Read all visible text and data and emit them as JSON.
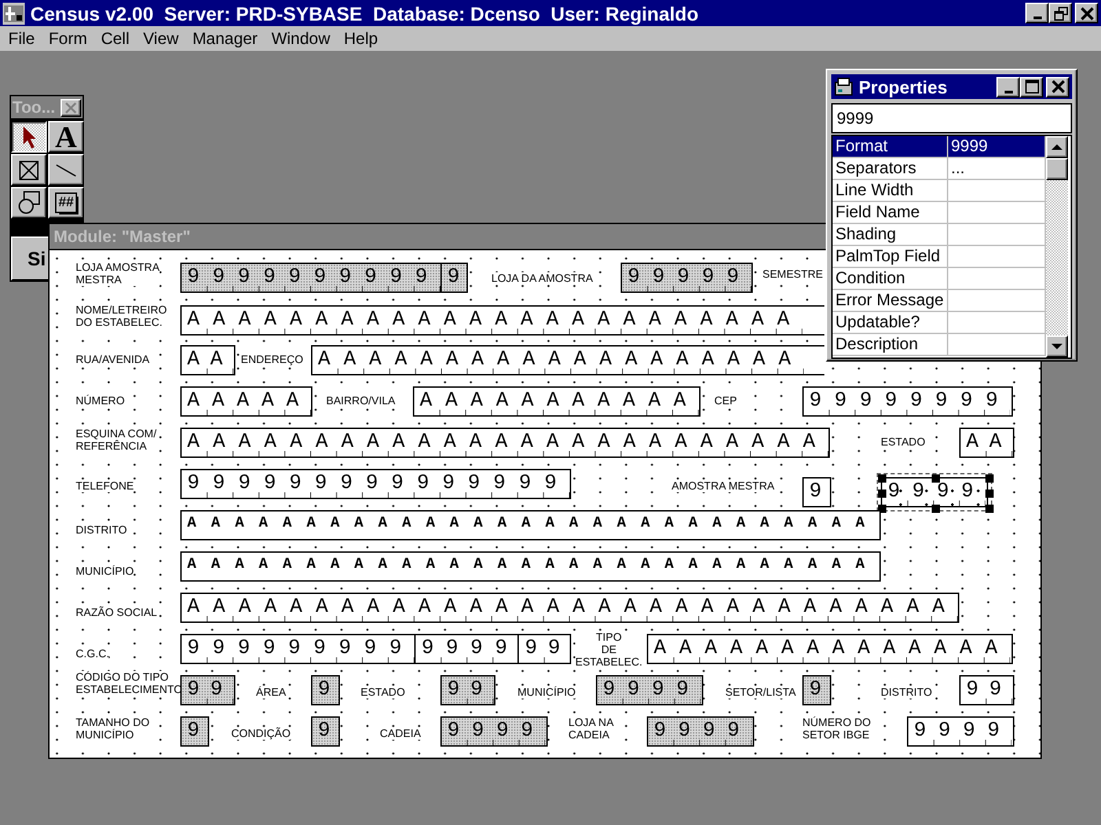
{
  "app": {
    "title": "Census v2.00  Server: PRD-SYBASE  Database: Dcenso  User: Reginaldo"
  },
  "menu": [
    "File",
    "Form",
    "Cell",
    "View",
    "Manager",
    "Window",
    "Help"
  ],
  "toolbox": {
    "title": "Too...",
    "tools": [
      {
        "kind": "pointer",
        "selected": true
      },
      {
        "kind": "text",
        "glyph": "A",
        "selected": false
      },
      {
        "kind": "frame",
        "selected": false
      },
      {
        "kind": "line",
        "selected": false
      },
      {
        "kind": "shapes",
        "selected": false
      },
      {
        "kind": "number",
        "glyph": "##",
        "selected": false
      }
    ],
    "button": "Si"
  },
  "module": {
    "title": "Module: \"Master\"",
    "items": [
      {
        "kind": "label",
        "text": "LOJA AMOSTRA\nMESTRA"
      },
      {
        "kind": "field",
        "groups": [
          "9999999999",
          "9"
        ],
        "shaded": true,
        "ticked": true,
        "selected": false
      },
      {
        "kind": "label",
        "text": "LOJA DA AMOSTRA"
      },
      {
        "kind": "field",
        "groups": [
          "99999"
        ],
        "shaded": true,
        "ticked": true,
        "selected": false
      },
      {
        "kind": "label",
        "text": "SEMESTRE"
      },
      {
        "kind": "label",
        "text": "NOME/LETREIRO\nDO ESTABELEC."
      },
      {
        "kind": "field",
        "groups": [
          "AAAAAAAAAAAAAAAAAAAAAAAA"
        ],
        "shaded": false,
        "ticked": true,
        "selected": false
      },
      {
        "kind": "label",
        "text": "RUA/AVENIDA"
      },
      {
        "kind": "field",
        "groups": [
          "AA"
        ],
        "shaded": false,
        "ticked": true,
        "selected": false
      },
      {
        "kind": "label",
        "text": "ENDEREÇO"
      },
      {
        "kind": "field",
        "groups": [
          "AAAAAAAAAAAAAAAAAAA"
        ],
        "shaded": false,
        "ticked": true,
        "selected": false
      },
      {
        "kind": "label",
        "text": "NÚMERO"
      },
      {
        "kind": "field",
        "groups": [
          "AAAAA"
        ],
        "shaded": false,
        "ticked": true,
        "selected": false
      },
      {
        "kind": "label",
        "text": "BAIRRO/VILA"
      },
      {
        "kind": "field",
        "groups": [
          "AAAAAAAAAAA"
        ],
        "shaded": false,
        "ticked": true,
        "selected": false
      },
      {
        "kind": "label",
        "text": "CEP"
      },
      {
        "kind": "field",
        "groups": [
          "99999999"
        ],
        "shaded": false,
        "ticked": true,
        "selected": false
      },
      {
        "kind": "label",
        "text": "ESQUINA COM/\nREFERÊNCIA"
      },
      {
        "kind": "field",
        "groups": [
          "AAAAAAAAAAAAAAAAAAAAAAAAA"
        ],
        "shaded": false,
        "ticked": true,
        "selected": false
      },
      {
        "kind": "label",
        "text": "ESTADO"
      },
      {
        "kind": "field",
        "groups": [
          "AA"
        ],
        "shaded": false,
        "ticked": true,
        "selected": false
      },
      {
        "kind": "label",
        "text": "TELEFONE"
      },
      {
        "kind": "field",
        "groups": [
          "999999999999999"
        ],
        "shaded": false,
        "ticked": true,
        "selected": false
      },
      {
        "kind": "label",
        "text": "AMOSTRA MESTRA"
      },
      {
        "kind": "field",
        "groups": [
          "9"
        ],
        "shaded": false,
        "selected": false
      },
      {
        "kind": "field",
        "groups": [
          "9999"
        ],
        "shaded": false,
        "ticked": true,
        "selected": true
      },
      {
        "kind": "label",
        "text": "DISTRITO"
      },
      {
        "kind": "field",
        "groups": [
          "AAAAAAAAAAAAAAAAAAAAAAAAAAAAA"
        ],
        "shaded": false,
        "ticked": false,
        "selected": false
      },
      {
        "kind": "label",
        "text": "MUNICÍPIO"
      },
      {
        "kind": "field",
        "groups": [
          "AAAAAAAAAAAAAAAAAAAAAAAAAAAAA"
        ],
        "shaded": false,
        "ticked": false,
        "selected": false
      },
      {
        "kind": "label",
        "text": "RAZÃO SOCIAL"
      },
      {
        "kind": "field",
        "groups": [
          "AAAAAAAAAAAAAAAAAAAAAAAAAAAAAA"
        ],
        "shaded": false,
        "ticked": true,
        "selected": false
      },
      {
        "kind": "label",
        "text": "C.G.C."
      },
      {
        "kind": "field",
        "groups": [
          "999999999",
          "9999",
          "99"
        ],
        "shaded": false,
        "ticked": true,
        "selected": false
      },
      {
        "kind": "label",
        "text": "TIPO\nDE\nESTABELEC."
      },
      {
        "kind": "field",
        "groups": [
          "AAAAAAAAAAAAAA"
        ],
        "shaded": false,
        "ticked": true,
        "selected": false
      },
      {
        "kind": "label",
        "text": "CÓDIGO DO TIPO\nESTABELECIMENTO"
      },
      {
        "kind": "field",
        "groups": [
          "99"
        ],
        "shaded": true,
        "ticked": true,
        "selected": false
      },
      {
        "kind": "label",
        "text": "ÁREA"
      },
      {
        "kind": "field",
        "groups": [
          "9"
        ],
        "shaded": true,
        "selected": false
      },
      {
        "kind": "label",
        "text": "ESTADO"
      },
      {
        "kind": "field",
        "groups": [
          "99"
        ],
        "shaded": true,
        "ticked": true,
        "selected": false
      },
      {
        "kind": "label",
        "text": "MUNICÍPIO"
      },
      {
        "kind": "field",
        "groups": [
          "9999"
        ],
        "shaded": true,
        "ticked": true,
        "selected": false
      },
      {
        "kind": "label",
        "text": "SETOR/LISTA"
      },
      {
        "kind": "field",
        "groups": [
          "9"
        ],
        "shaded": true,
        "selected": false
      },
      {
        "kind": "label",
        "text": "DISTRITO"
      },
      {
        "kind": "field",
        "groups": [
          "99"
        ],
        "shaded": false,
        "ticked": true,
        "selected": false
      },
      {
        "kind": "label",
        "text": "TAMANHO DO\nMUNICÍPIO"
      },
      {
        "kind": "field",
        "groups": [
          "9"
        ],
        "shaded": true,
        "selected": false
      },
      {
        "kind": "label",
        "text": "CONDIÇÃO"
      },
      {
        "kind": "field",
        "groups": [
          "9"
        ],
        "shaded": true,
        "selected": false
      },
      {
        "kind": "label",
        "text": "CADEIA"
      },
      {
        "kind": "field",
        "groups": [
          "9999"
        ],
        "shaded": true,
        "ticked": true,
        "selected": false
      },
      {
        "kind": "label",
        "text": "LOJA NA\nCADEIA"
      },
      {
        "kind": "field",
        "groups": [
          "9999"
        ],
        "shaded": true,
        "ticked": true,
        "selected": false
      },
      {
        "kind": "label",
        "text": "NÚMERO DO\nSETOR IBGE"
      },
      {
        "kind": "field",
        "groups": [
          "9999"
        ],
        "shaded": false,
        "ticked": true,
        "selected": false
      }
    ]
  },
  "properties": {
    "title": "Properties",
    "value": "9999",
    "rows": [
      {
        "name": "Format",
        "value": "9999",
        "selected": true
      },
      {
        "name": "Separators",
        "value": "...",
        "selected": false
      },
      {
        "name": "Line Width",
        "selected": false
      },
      {
        "name": "Field Name",
        "selected": false
      },
      {
        "name": "Shading",
        "selected": false
      },
      {
        "name": "PalmTop Field",
        "selected": false
      },
      {
        "name": "Condition",
        "selected": false
      },
      {
        "name": "Error Message",
        "selected": false
      },
      {
        "name": "Updatable?",
        "selected": false
      },
      {
        "name": "Description",
        "selected": false
      }
    ]
  }
}
